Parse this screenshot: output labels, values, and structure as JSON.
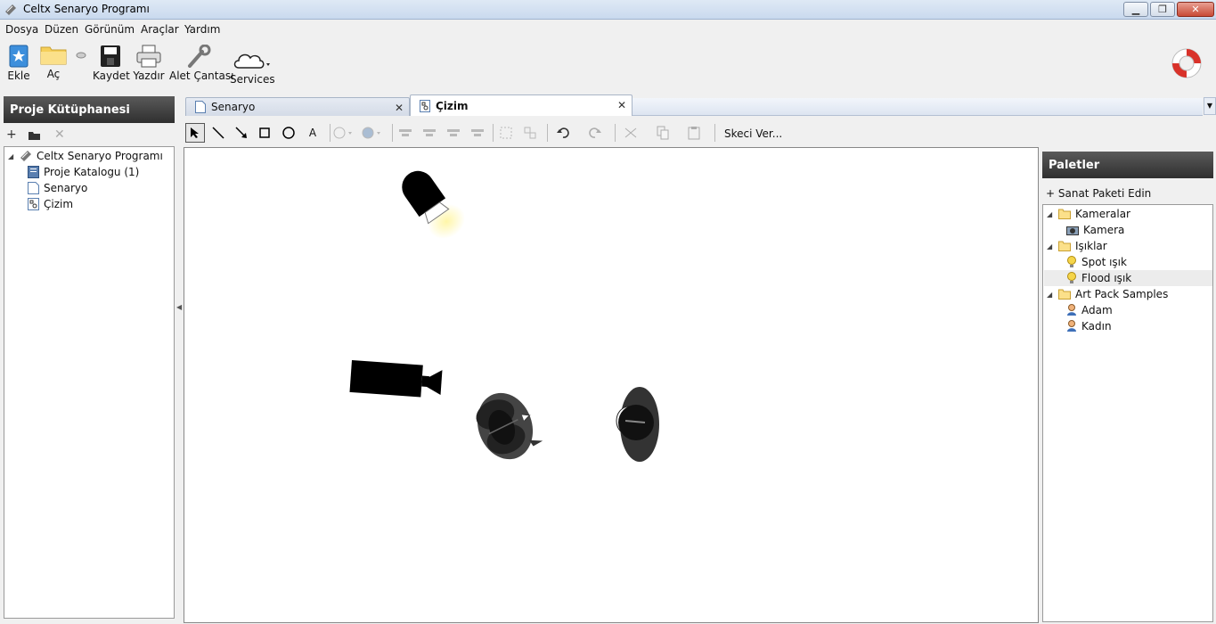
{
  "window": {
    "title": "Celtx Senaryo Programı"
  },
  "menu": [
    "Dosya",
    "Düzen",
    "Görünüm",
    "Araçlar",
    "Yardım"
  ],
  "toolbar": {
    "add_label": "Ekle",
    "open_label": "Aç",
    "save_label": "Kaydet",
    "print_label": "Yazdır",
    "toolkit_label": "Alet Çantası",
    "services_label": "Services"
  },
  "library": {
    "header": "Proje Kütüphanesi",
    "tree": {
      "root": "Celtx Senaryo Programı",
      "children": [
        "Proje Katalogu (1)",
        "Senaryo",
        "Çizim"
      ]
    }
  },
  "tabs": [
    {
      "label": "Senaryo",
      "active": false
    },
    {
      "label": "Çizim",
      "active": true
    }
  ],
  "drawing_toolbar": {
    "sketch_button": "Skeci Ver..."
  },
  "palettes": {
    "header": "Paletler",
    "add_pack": "+ Sanat Paketi Edin",
    "groups": [
      {
        "label": "Kameralar",
        "items": [
          "Kamera"
        ]
      },
      {
        "label": "Işıklar",
        "items": [
          "Spot ışık",
          "Flood ışık"
        ]
      },
      {
        "label": "Art Pack Samples",
        "items": [
          "Adam",
          "Kadın"
        ]
      }
    ],
    "highlighted_item": "Flood ışık"
  },
  "canvas_objects": [
    "light",
    "camera",
    "person-1",
    "person-2"
  ],
  "colors": {
    "pane_header": "#3c3c3c",
    "tab_active": "#ffffff",
    "canvas": "#ffffff"
  }
}
